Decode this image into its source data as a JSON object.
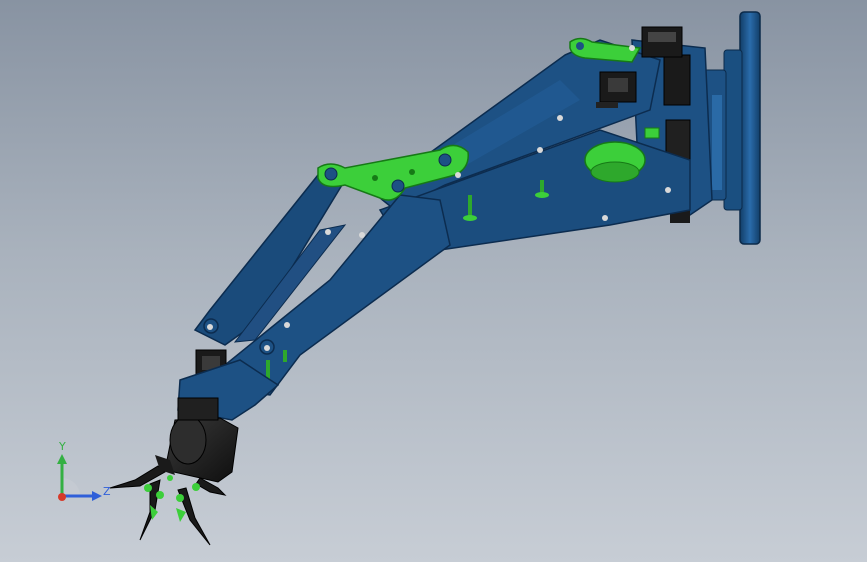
{
  "viewport": {
    "background_top": "#8893a2",
    "background_bottom": "#c7cdd5"
  },
  "model": {
    "body_color": "#1d5184",
    "body_edge": "#0c2c4f",
    "link_color": "#34c734",
    "servo_color": "#1b1b1b",
    "plate_color": "#1e5a92"
  },
  "triad": {
    "y_label": "Y",
    "z_label": "Z",
    "y_color": "#34b043",
    "z_color": "#2f5fd9",
    "x_color": "#d63a2a",
    "icon": "coordinate-triad-icon"
  }
}
